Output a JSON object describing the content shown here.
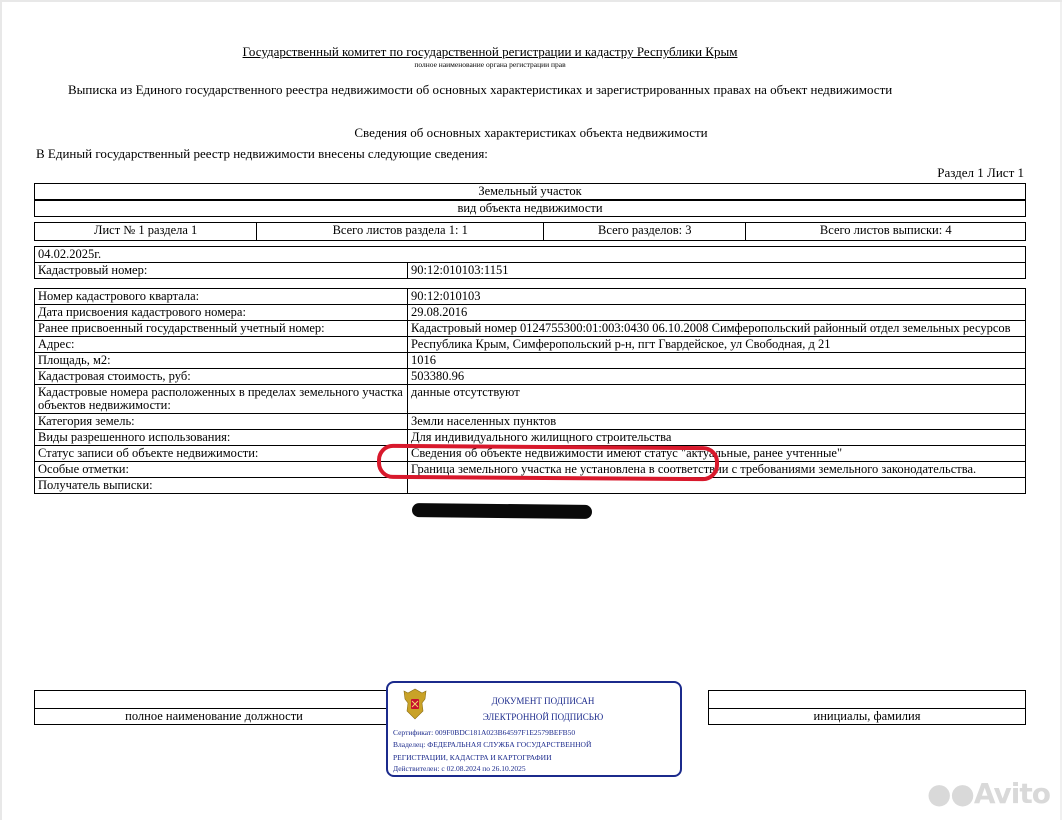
{
  "header": {
    "agency": "Государственный комитет по государственной регистрации и кадастру Республики Крым",
    "agency_sub": "полное наименование органа регистрации прав",
    "doc_title": "Выписка из Единого государственного реестра недвижимости об основных характеристиках и зарегистрированных правах на объект недвижимости",
    "section_title": "Сведения об основных характеристиках объекта недвижимости",
    "intro": "В Единый государственный реестр недвижимости внесены следующие сведения:",
    "sheet_ref": "Раздел 1 Лист 1"
  },
  "object": {
    "type": "Земельный участок",
    "type_caption": "вид объекта недвижимости"
  },
  "sheets": {
    "sheet_no": "Лист № 1 раздела 1",
    "section_sheets": "Всего листов раздела 1: 1",
    "sections": "Всего разделов: 3",
    "total_sheets": "Всего листов выписки: 4"
  },
  "date": "04.02.2025г.",
  "cadastral": {
    "label": "Кадастровый номер:",
    "value": "90:12:010103:1151"
  },
  "rows": [
    {
      "label": "Номер кадастрового квартала:",
      "value": "90:12:010103"
    },
    {
      "label": "Дата присвоения кадастрового номера:",
      "value": "29.08.2016"
    },
    {
      "label": "Ранее присвоенный государственный учетный номер:",
      "value": "Кадастровый номер 0124755300:01:003:0430 06.10.2008 Симферопольский районный отдел земельных ресурсов"
    },
    {
      "label": "Адрес:",
      "value": "Республика Крым, Симферопольский р-н, пгт Гвардейское, ул Свободная, д 21"
    },
    {
      "label": "Площадь, м2:",
      "value": "1016"
    },
    {
      "label": "Кадастровая стоимость, руб:",
      "value": "503380.96"
    },
    {
      "label": "Кадастровые номера расположенных в пределах земельного участка объектов недвижимости:",
      "value": "данные отсутствуют"
    },
    {
      "label": "Категория земель:",
      "value": "Земли населенных пунктов"
    },
    {
      "label": "Виды разрешенного использования:",
      "value": "Для индивидуального жилищного строительства"
    },
    {
      "label": "Статус записи об объекте недвижимости:",
      "value": "Сведения об объекте недвижимости имеют статус \"актуальные, ранее учтенные\""
    },
    {
      "label": "Особые отметки:",
      "value": "Граница земельного участка не установлена в соответствии с требованиями земельного законодательства."
    },
    {
      "label": "Получатель выписки:",
      "value": ""
    }
  ],
  "signature": {
    "position_caption": "полное наименование должности",
    "initials_caption": "инициалы, фамилия",
    "stamp": {
      "line1": "ДОКУМЕНТ ПОДПИСАН",
      "line2": "ЭЛЕКТРОННОЙ ПОДПИСЬЮ",
      "certificate": "Сертификат: 009F0BDC181A023B64597F1E2579BEFB50",
      "owner1": "Владелец: ФЕДЕРАЛЬНАЯ СЛУЖБА ГОСУДАРСТВЕННОЙ",
      "owner2": "РЕГИСТРАЦИИ, КАДАСТРА И КАРТОГРАФИИ",
      "valid": "Действителен: с 02.08.2024 по 26.10.2025"
    }
  },
  "watermark": "Avito",
  "colors": {
    "stamp": "#1b2a8c",
    "annotation": "#d8192c"
  }
}
